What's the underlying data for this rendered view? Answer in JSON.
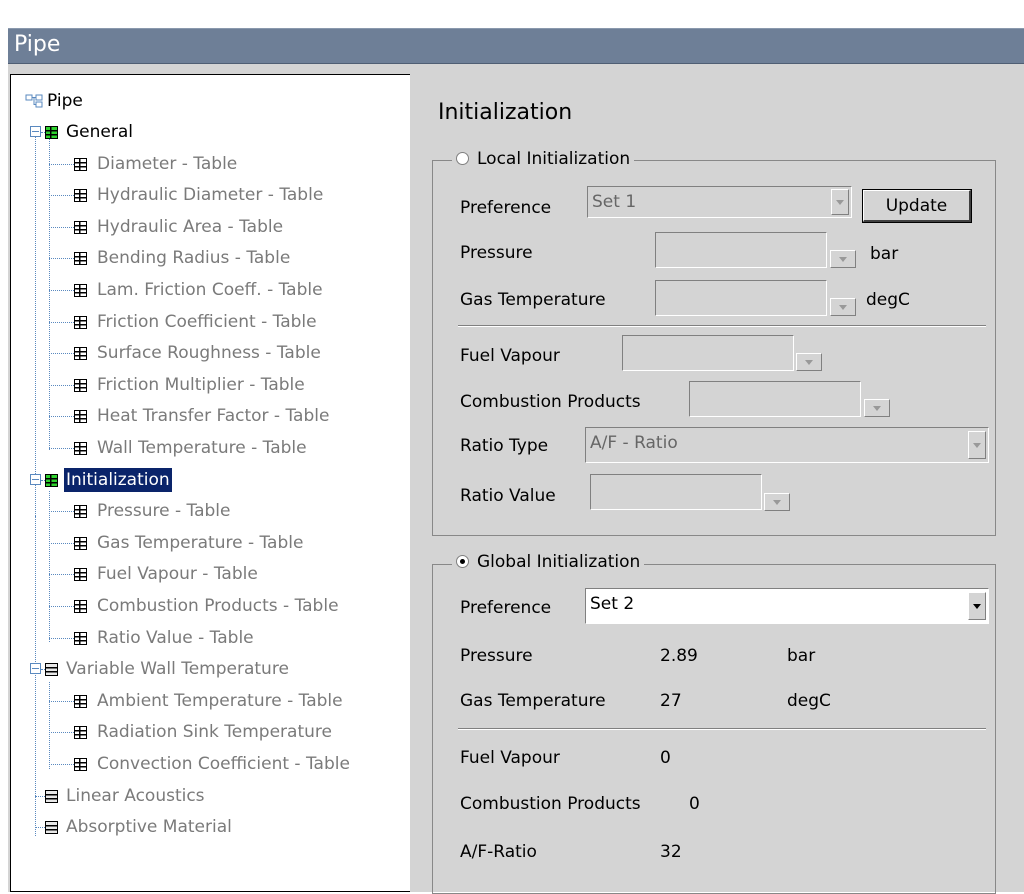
{
  "window": {
    "title": "Pipe"
  },
  "tree": {
    "root": "Pipe",
    "nodes": [
      {
        "label": "General",
        "icon": "green"
      },
      {
        "label": "Diameter - Table",
        "icon": "table"
      },
      {
        "label": "Hydraulic Diameter - Table",
        "icon": "table"
      },
      {
        "label": "Hydraulic Area - Table",
        "icon": "table"
      },
      {
        "label": "Bending Radius - Table",
        "icon": "table"
      },
      {
        "label": "Lam. Friction Coeff. - Table",
        "icon": "table"
      },
      {
        "label": "Friction Coefficient - Table",
        "icon": "table"
      },
      {
        "label": "Surface Roughness - Table",
        "icon": "table"
      },
      {
        "label": "Friction Multiplier - Table",
        "icon": "table"
      },
      {
        "label": "Heat Transfer Factor - Table",
        "icon": "table"
      },
      {
        "label": "Wall Temperature - Table",
        "icon": "table"
      },
      {
        "label": "Initialization",
        "icon": "green"
      },
      {
        "label": "Pressure - Table",
        "icon": "table"
      },
      {
        "label": "Gas Temperature - Table",
        "icon": "table"
      },
      {
        "label": "Fuel Vapour - Table",
        "icon": "table"
      },
      {
        "label": "Combustion Products - Table",
        "icon": "table"
      },
      {
        "label": "Ratio Value - Table",
        "icon": "table"
      },
      {
        "label": "Variable Wall Temperature",
        "icon": "grey"
      },
      {
        "label": "Ambient Temperature - Table",
        "icon": "table"
      },
      {
        "label": "Radiation Sink Temperature",
        "icon": "table"
      },
      {
        "label": "Convection Coefficient - Table",
        "icon": "table"
      },
      {
        "label": "Linear Acoustics",
        "icon": "grey"
      },
      {
        "label": "Absorptive Material",
        "icon": "grey"
      }
    ]
  },
  "panel": {
    "title": "Initialization",
    "local": {
      "legend": "Local Initialization",
      "preference_label": "Preference",
      "preference_value": "Set 1",
      "update_button": "Update",
      "pressure_label": "Pressure",
      "pressure_unit": "bar",
      "gas_temp_label": "Gas Temperature",
      "gas_temp_unit": "degC",
      "fuel_vapour_label": "Fuel Vapour",
      "combustion_label": "Combustion Products",
      "ratio_type_label": "Ratio Type",
      "ratio_type_value": "A/F - Ratio",
      "ratio_value_label": "Ratio Value"
    },
    "global": {
      "legend": "Global Initialization",
      "preference_label": "Preference",
      "preference_value": "Set 2",
      "pressure_label": "Pressure",
      "pressure_value": "2.89",
      "pressure_unit": "bar",
      "gas_temp_label": "Gas Temperature",
      "gas_temp_value": "27",
      "gas_temp_unit": "degC",
      "fuel_vapour_label": "Fuel Vapour",
      "fuel_vapour_value": "0",
      "combustion_label": "Combustion Products",
      "combustion_value": "0",
      "ratio_label": "A/F-Ratio",
      "ratio_value": "32"
    }
  },
  "colors": {
    "title_bar": "#6e7f97",
    "selection": "#0a246a",
    "folder_green": "#2fd12f"
  }
}
